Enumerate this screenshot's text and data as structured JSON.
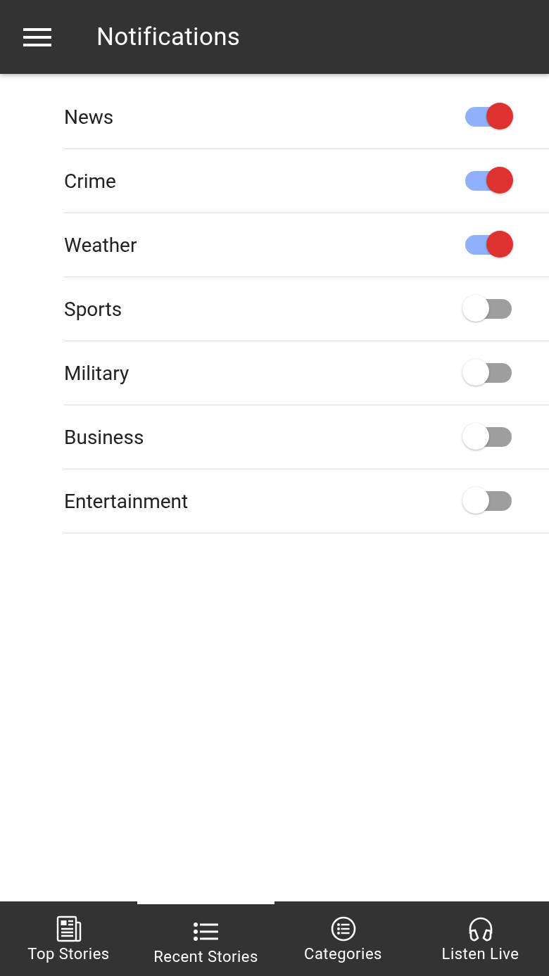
{
  "app_bar": {
    "title": "Notifications"
  },
  "settings": [
    {
      "label": "News",
      "on": true
    },
    {
      "label": "Crime",
      "on": true
    },
    {
      "label": "Weather",
      "on": true
    },
    {
      "label": "Sports",
      "on": false
    },
    {
      "label": "Military",
      "on": false
    },
    {
      "label": "Business",
      "on": false
    },
    {
      "label": "Entertainment",
      "on": false
    }
  ],
  "bottom_nav": [
    {
      "label": "Top Stories",
      "selected": false
    },
    {
      "label": "Recent Stories",
      "selected": true
    },
    {
      "label": "Categories",
      "selected": false
    },
    {
      "label": "Listen Live",
      "selected": false
    }
  ]
}
